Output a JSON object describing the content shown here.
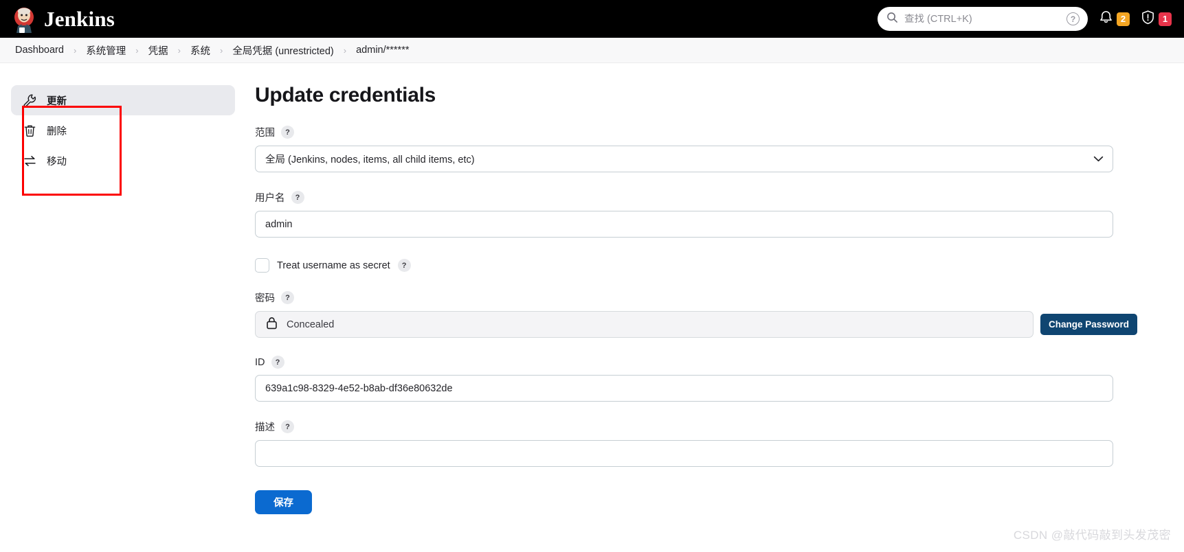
{
  "header": {
    "brand": "Jenkins",
    "logo_icon": "jenkins-butler-icon",
    "search": {
      "placeholder": "查找 (CTRL+K)",
      "value": "",
      "icon": "search-icon"
    },
    "help_icon": "help-circle-icon",
    "notifications": {
      "icon": "bell-icon",
      "count": "2",
      "color": "#f5a623"
    },
    "security": {
      "icon": "shield-exclamation-icon",
      "count": "1",
      "color": "#e8344b"
    }
  },
  "breadcrumb": {
    "separator": "›",
    "items": [
      {
        "label": "Dashboard"
      },
      {
        "label": "系统管理"
      },
      {
        "label": "凭据"
      },
      {
        "label": "系统"
      },
      {
        "label": "全局凭据 (unrestricted)"
      },
      {
        "label": "admin/******"
      }
    ]
  },
  "sidebar": {
    "items": [
      {
        "label": "更新",
        "icon": "wrench-icon",
        "active": true
      },
      {
        "label": "删除",
        "icon": "trash-icon",
        "active": false
      },
      {
        "label": "移动",
        "icon": "move-arrows-icon",
        "active": false
      }
    ]
  },
  "main": {
    "title": "Update credentials",
    "help_glyph": "?",
    "scope": {
      "label": "范围",
      "value": "全局 (Jenkins, nodes, items, all child items, etc)",
      "chevron_icon": "chevron-down-icon"
    },
    "username": {
      "label": "用户名",
      "value": "admin",
      "placeholder": ""
    },
    "treat_secret": {
      "label": "Treat username as secret",
      "checked": false
    },
    "password": {
      "label": "密码",
      "value": "Concealed",
      "lock_icon": "lock-icon",
      "change_button": "Change Password"
    },
    "id": {
      "label": "ID",
      "value": "639a1c98-8329-4e52-b8ab-df36e80632de",
      "placeholder": ""
    },
    "description": {
      "label": "描述",
      "value": "",
      "placeholder": ""
    },
    "save_button": "保存"
  },
  "watermark": "CSDN @敲代码敲到头发茂密",
  "colors": {
    "header_bg": "#000000",
    "accent_primary": "#0b6ad0",
    "accent_dark": "#0f4571",
    "annotation": "#fc0000",
    "active_item_bg": "#e9eaee"
  }
}
